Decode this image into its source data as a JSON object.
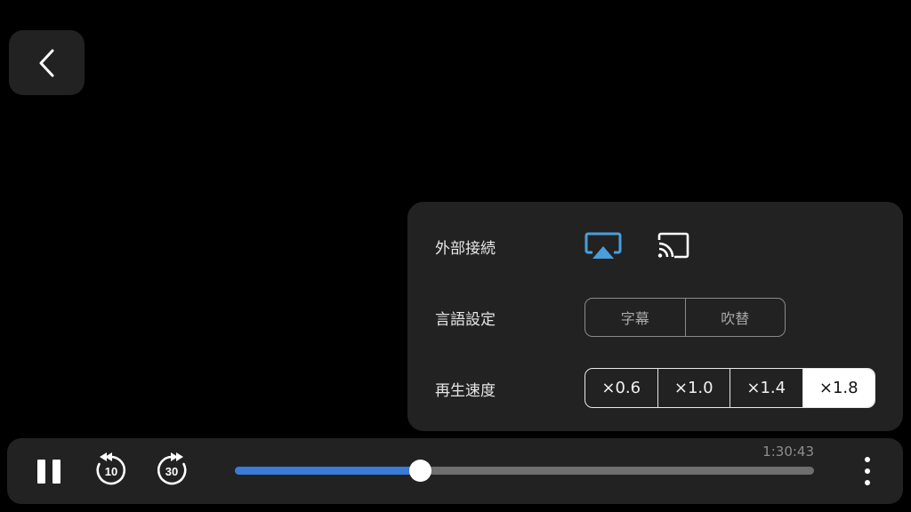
{
  "back": {
    "icon": "chevron-left-icon"
  },
  "panel": {
    "external": {
      "label": "外部接続",
      "airplay_icon": "airplay-icon",
      "cast_icon": "cast-icon",
      "airplay_color": "#4a9eda"
    },
    "language": {
      "label": "言語設定",
      "options": [
        "字幕",
        "吹替"
      ]
    },
    "speed": {
      "label": "再生速度",
      "options": [
        "×0.6",
        "×1.0",
        "×1.4",
        "×1.8"
      ],
      "selected": "×1.8"
    }
  },
  "player": {
    "time": "1:30:43",
    "progress": 0.32,
    "accent": "#3a7bd5",
    "rewind_label": "10",
    "forward_label": "30",
    "pause_icon": "pause-icon",
    "more_icon": "more-vertical-icon"
  }
}
